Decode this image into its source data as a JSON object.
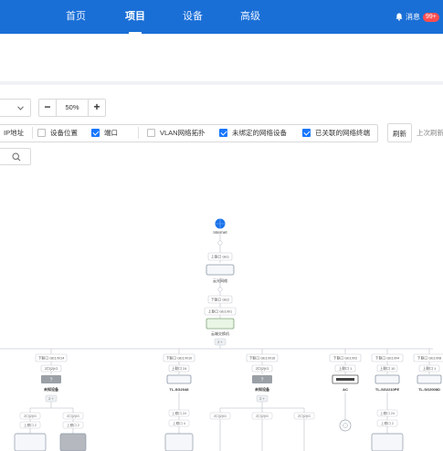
{
  "topnav": {
    "items": [
      {
        "label": "首页",
        "active": false
      },
      {
        "label": "项目",
        "active": true
      },
      {
        "label": "设备",
        "active": false
      },
      {
        "label": "高级",
        "active": false
      }
    ],
    "message_label": "消息",
    "message_count": "99+"
  },
  "toolbar": {
    "select_value": "",
    "zoom_minus": "−",
    "zoom_value": "50%",
    "zoom_plus": "+",
    "filters": {
      "ip_label": "IP地址",
      "device_position": {
        "label": "设备位置",
        "checked": false
      },
      "port": {
        "label": "端口",
        "checked": true
      },
      "vlan": {
        "label": "VLAN网络拓扑",
        "checked": false
      },
      "unbound": {
        "label": "未绑定的网络设备",
        "checked": true
      },
      "associated": {
        "label": "已关联的网络终端",
        "checked": true
      }
    },
    "refresh_label": "刷新",
    "last_refresh_label": "上次刷新"
  },
  "topology": {
    "internet_label": "Internet",
    "gateway": {
      "up_port": "上联口 GE1",
      "label": "云光网络",
      "down_port": "下联口 GE2"
    },
    "core": {
      "up_port": "上联口 GE1/0/1",
      "label": "云端交换机",
      "badge": "2 +"
    },
    "branches": [
      {
        "down_port": "下联口 GE1/0/14",
        "up_port": "2口(2)IG",
        "label": "未知设备",
        "badge": "2 +",
        "kind": "unknown"
      },
      {
        "down_port": "下联口 GE1/0/10",
        "up_port": "上联口 24",
        "label": "TL-SG2048",
        "badge": "",
        "kind": "switch"
      },
      {
        "down_port": "下联口 GE1/0/16",
        "up_port": "2口(2)IG",
        "label": "未知设备",
        "badge": "2 +",
        "kind": "unknown"
      },
      {
        "down_port": "下联口 GE1/0/2",
        "up_port": "上联口 1",
        "label": "AC",
        "badge": "",
        "kind": "ac"
      },
      {
        "down_port": "下联口 GE1/0/4",
        "up_port": "上联口 10",
        "label": "TL-SG2210PE",
        "badge": "",
        "kind": "switch"
      },
      {
        "down_port": "下联口 GE1/0/8",
        "up_port": "上联口 1",
        "label": "TL-SG2008D",
        "badge": "",
        "kind": "switch"
      }
    ],
    "sub_labels": {
      "port_a": "2口(2)IG",
      "port_b": "上联口 2",
      "port_c": "上联口 24",
      "port_d": "上联口 4"
    }
  }
}
